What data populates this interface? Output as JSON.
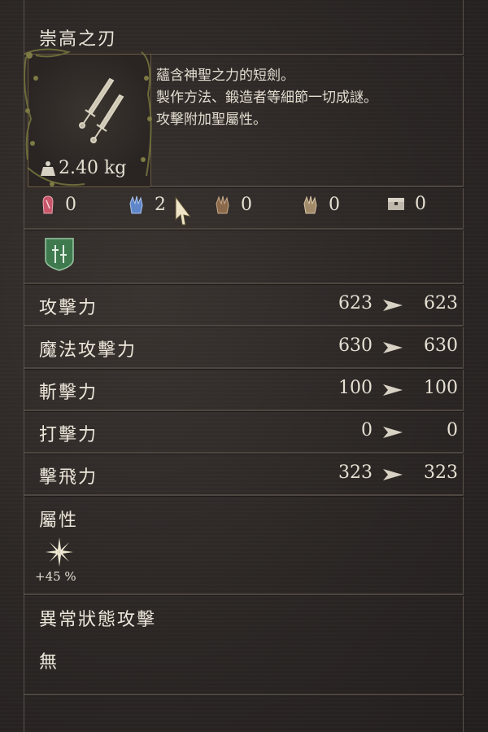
{
  "item": {
    "name": "崇高之刃",
    "description": [
      "蘊含神聖之力的短劍。",
      "製作方法、鍛造者等細節一切成謎。",
      "攻擊附加聖屬性。"
    ],
    "weight": "2.40 kg",
    "icon": "twin-daggers-icon"
  },
  "requirements": [
    {
      "icon": "strength-hand-icon",
      "value": "0",
      "color": "#c9566a"
    },
    {
      "icon": "magic-hand-icon",
      "value": "2",
      "color": "#5f86c8"
    },
    {
      "icon": "brown-hand-icon-1",
      "value": "0",
      "color": "#8a6a4a"
    },
    {
      "icon": "brown-hand-icon-2",
      "value": "0",
      "color": "#a08a6a"
    },
    {
      "icon": "chest-icon",
      "value": "0",
      "color": "#bfb8ad"
    }
  ],
  "badge": {
    "icon": "dagger-type-badge-icon",
    "color": "#3f7a4f"
  },
  "stats": [
    {
      "label": "攻擊力",
      "before": "623",
      "after": "623"
    },
    {
      "label": "魔法攻擊力",
      "before": "630",
      "after": "630"
    },
    {
      "label": "斬擊力",
      "before": "100",
      "after": "100"
    },
    {
      "label": "打擊力",
      "before": "0",
      "after": "0"
    },
    {
      "label": "擊飛力",
      "before": "323",
      "after": "323"
    }
  ],
  "attribute": {
    "title": "屬性",
    "icon": "holy-star-icon",
    "value": "+45 %"
  },
  "status": {
    "title": "異常狀態攻擊",
    "value": "無"
  },
  "colors": {
    "background": "#2a2624",
    "text": "#e8e2d6",
    "divider": "#4e4640",
    "frame_gold": "#6a5c40"
  }
}
